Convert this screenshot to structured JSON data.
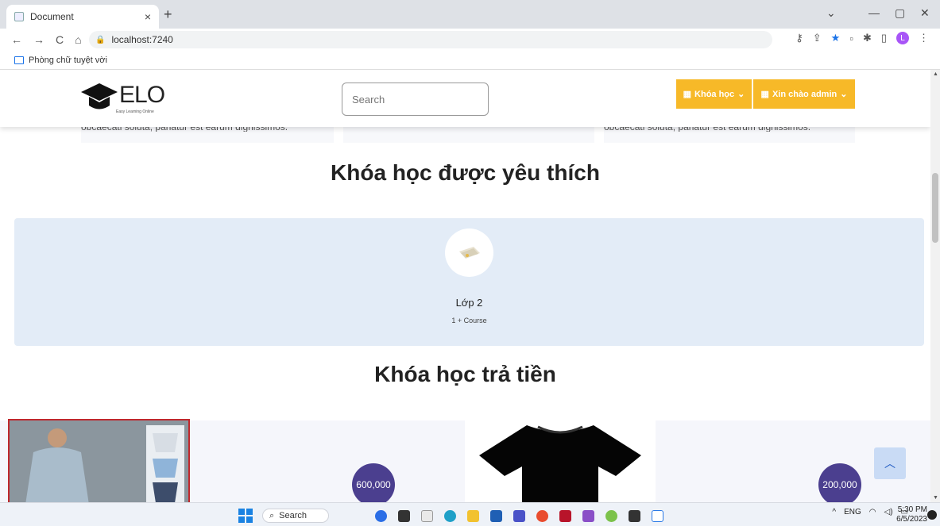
{
  "browser": {
    "tab_title": "Document",
    "tab_close": "×",
    "new_tab": "+",
    "win_min": "—",
    "win_restore": "▢",
    "win_close": "✕",
    "win_chevron": "⌄",
    "url": "localhost:7240",
    "bookmark": "Phòng chữ tuyệt vời",
    "profile_initial": "L"
  },
  "nav": {
    "back": "←",
    "forward": "→",
    "reload": "C",
    "home": "⌂"
  },
  "site": {
    "logo_text": "ELO",
    "logo_sub": "Easy Learning Online",
    "search_placeholder": "Search",
    "courses_btn": "Khóa học",
    "user_btn": "Xin chào admin"
  },
  "top_cards": [
    {
      "text": "obcaecati soluta, pariatur est earum dignissimos."
    },
    {
      "text": ""
    },
    {
      "text": "obcaecati soluta, pariatur est earum dignissimos."
    }
  ],
  "favorite": {
    "heading": "Khóa học được yêu thích",
    "class_name": "Lớp 2",
    "class_count": "1 + Course"
  },
  "paid": {
    "heading": "Khóa học trả tiền",
    "products": [
      {
        "price": "600,000"
      },
      {
        "price": "200,000"
      }
    ]
  },
  "taskbar": {
    "search": "Search",
    "lang": "ENG",
    "time": "5:30 PM",
    "date": "6/5/2023"
  }
}
